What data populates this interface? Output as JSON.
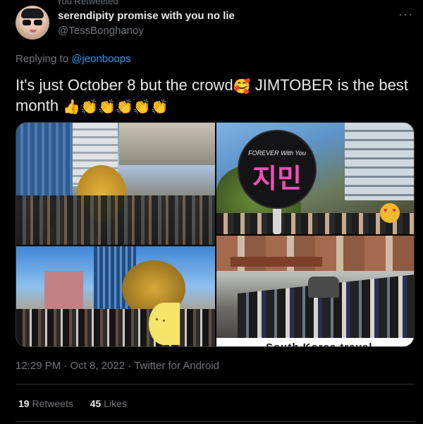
{
  "retweet_hint": "You Retweeted",
  "author": {
    "display_name": "serendipity promise with you no lie",
    "handle": "@TessBonghanoy",
    "avatar_icon": "avatar-sunglasses-cap"
  },
  "more_icon": "···",
  "reply": {
    "prefix": "Replying to",
    "mention": "@jeonboops"
  },
  "tweet": {
    "text_part1": "It's just October 8 but the crowd",
    "emoji1": "🥰",
    "text_part2": " JIMTOBER is the best month ",
    "emojis_end": "👍👏👏👏👏👏"
  },
  "media": {
    "fan_top_text": "FOREVER With You",
    "fan_name": "지민",
    "caption_partial": "South Korea travel"
  },
  "meta": {
    "time": "12:29 PM",
    "date": "Oct 8, 2022",
    "source": "Twitter for Android",
    "line": "12:29 PM · Oct 8, 2022 · Twitter for Android"
  },
  "stats": {
    "retweets_count": "19",
    "retweets_label": "Retweets",
    "likes_count": "45",
    "likes_label": "Likes"
  },
  "colors": {
    "background": "#000000",
    "text": "#e7e9ea",
    "muted": "#71767b",
    "link": "#1d9bf0",
    "border": "#2f3336"
  }
}
